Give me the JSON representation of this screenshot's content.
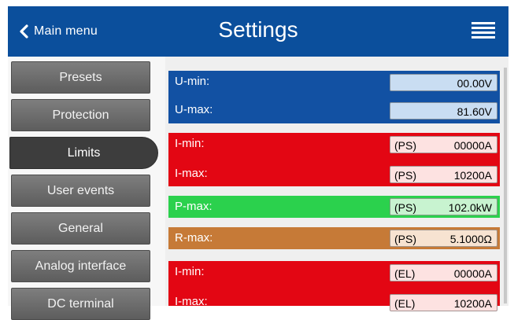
{
  "header": {
    "back_label": "Main menu",
    "title": "Settings",
    "menu_icon": "hamburger-menu-icon",
    "back_icon": "chevron-left-icon",
    "color": "#0b4f9c"
  },
  "sidebar": {
    "items": [
      {
        "label": "Presets"
      },
      {
        "label": "Protection"
      },
      {
        "label": "Limits"
      },
      {
        "label": "User events"
      },
      {
        "label": "General"
      },
      {
        "label": "Analog interface"
      },
      {
        "label": "DC terminal"
      }
    ],
    "active": "Limits"
  },
  "limits": [
    {
      "label": "U-min:",
      "prefix": "",
      "value": "00.00V"
    },
    {
      "label": "U-max:",
      "prefix": "",
      "value": "81.60V"
    },
    {
      "label": "I-min:",
      "prefix": "(PS)",
      "value": "00000A"
    },
    {
      "label": "I-max:",
      "prefix": "(PS)",
      "value": "10200A"
    },
    {
      "label": "P-max:",
      "prefix": "(PS)",
      "value": "102.0kW"
    },
    {
      "label": "R-max:",
      "prefix": "(PS)",
      "value": "5.1000Ω"
    },
    {
      "label": "I-min:",
      "prefix": "(EL)",
      "value": "00000A"
    },
    {
      "label": "I-max:",
      "prefix": "(EL)",
      "value": "10200A"
    }
  ],
  "colors": {
    "voltage": "#1251a3",
    "current": "#e30613",
    "power": "#2bd14d",
    "resistance": "#c67a37"
  }
}
